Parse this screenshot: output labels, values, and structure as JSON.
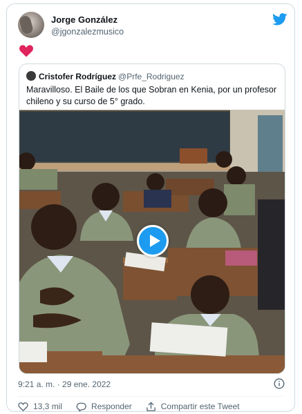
{
  "tweet": {
    "author_name": "Jorge González",
    "author_handle": "@jgonzalezmusico",
    "reaction_emoji": "heart"
  },
  "quoted_tweet": {
    "author_name": "Cristofer Rodríguez",
    "author_handle": "@Prfe_Rodriguez",
    "text": "Maravilloso. El Baile de los que Sobran en Kenia, por un profesor chileno y su curso de 5° grado."
  },
  "meta": {
    "timestamp": "9:21 a. m. · 29 ene. 2022"
  },
  "actions": {
    "likes": "13,3 mil",
    "reply_label": "Responder",
    "share_label": "Compartir este Tweet"
  },
  "colors": {
    "accent": "#1d9bf0",
    "heart": "#f91880"
  }
}
